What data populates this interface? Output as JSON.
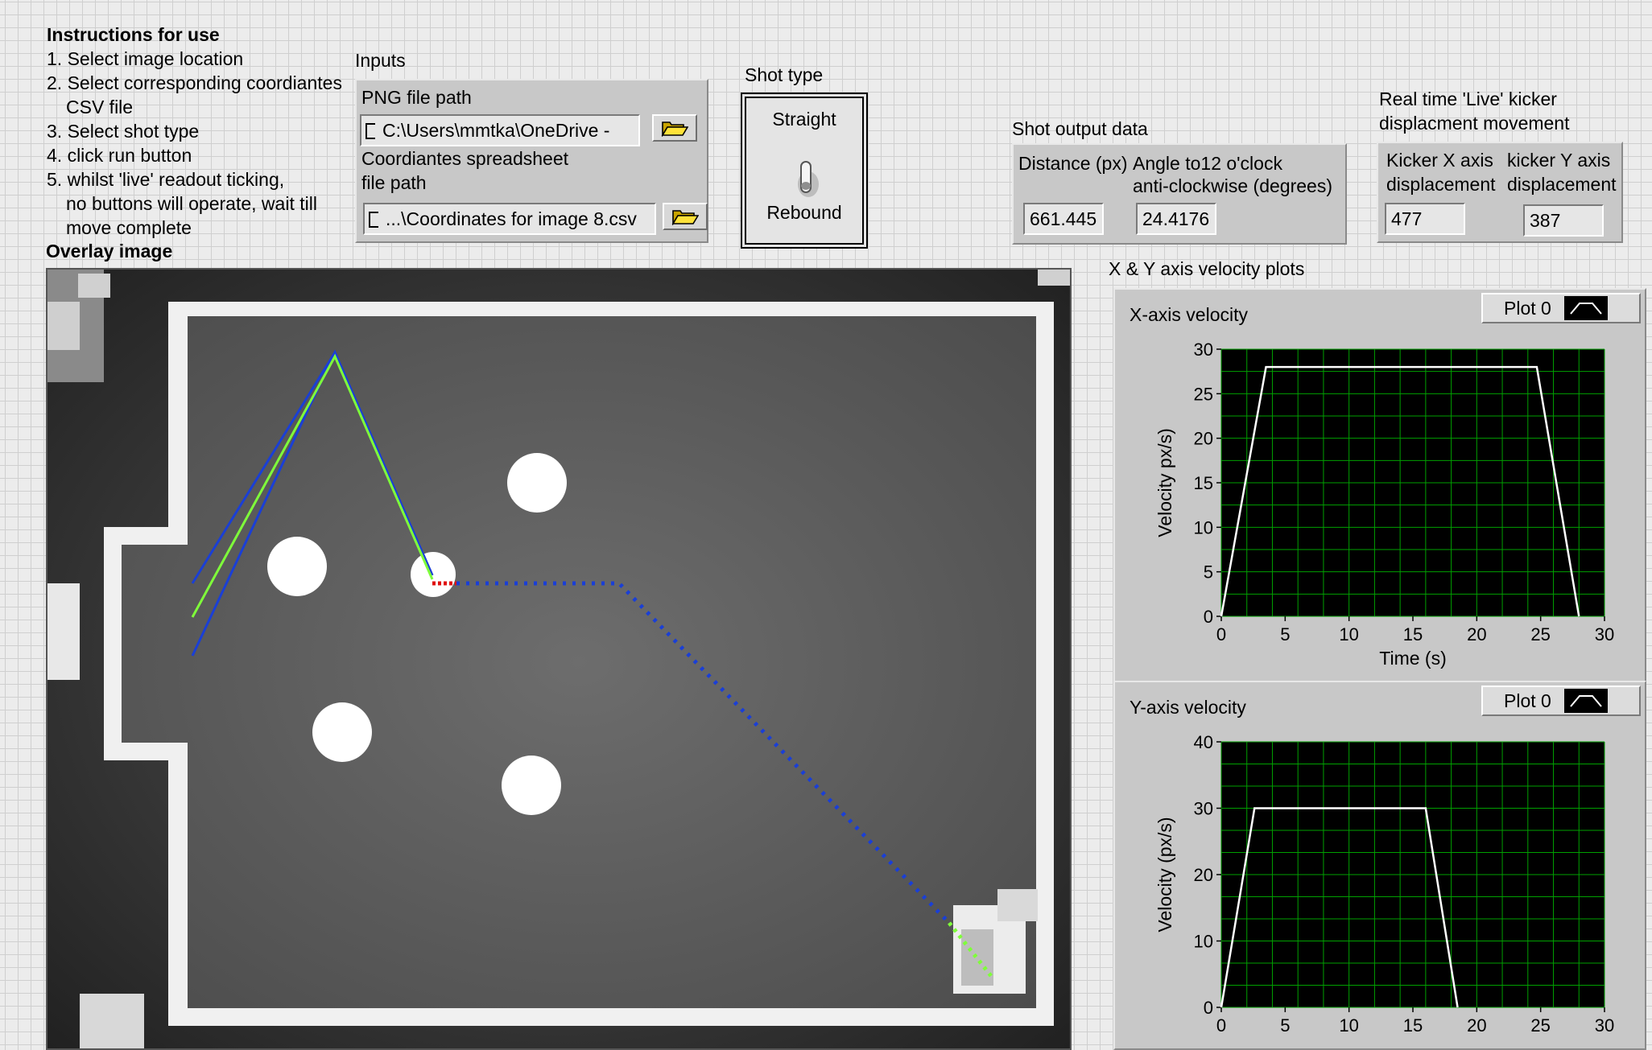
{
  "instructions": {
    "title": "Instructions for use",
    "steps": [
      "1. Select image location",
      "2. Select corresponding coordiantes",
      "CSV file",
      "3. Select shot type",
      "4. click run button",
      "5. whilst 'live' readout ticking,",
      "no buttons will operate, wait till",
      "move complete"
    ]
  },
  "inputs": {
    "section_label": "Inputs",
    "png_label": "PNG file path",
    "png_value": "C:\\Users\\mmtka\\OneDrive -",
    "csv_label_line1": "Coordiantes spreadsheet",
    "csv_label_line2": "file path",
    "csv_value": "...\\Coordinates for image 8.csv"
  },
  "shot_type": {
    "label": "Shot type",
    "option_top": "Straight",
    "option_bottom": "Rebound",
    "selected": "Rebound"
  },
  "shot_output": {
    "section_label": "Shot output data",
    "distance_label": "Distance (px)",
    "angle_label_line1": "Angle to12 o'clock",
    "angle_label_line2": "anti-clockwise (degrees)",
    "distance_value": "661.445",
    "angle_value": "24.4176"
  },
  "kicker": {
    "section_label_line1": "Real time 'Live' kicker",
    "section_label_line2": "displacment movement",
    "x_label_line1": "Kicker X axis",
    "x_label_line2": "displacement",
    "y_label_line1": "kicker Y axis",
    "y_label_line2": "displacement",
    "x_value": "477",
    "y_value": "387"
  },
  "overlay": {
    "label": "Overlay image"
  },
  "velocity_plots": {
    "section_label": "X & Y axis velocity plots",
    "x_plot": {
      "title": "X-axis velocity",
      "legend": "Plot 0"
    },
    "y_plot": {
      "title": "Y-axis velocity",
      "legend": "Plot 0"
    }
  },
  "colors": {
    "plot_bg": "#000000",
    "grid": "#00a000",
    "trace": "#ffffff",
    "path_blue": "#1a3fd6",
    "path_green": "#7fff3a",
    "path_red": "#e01010"
  },
  "icons": {
    "browse": "folder-open-icon",
    "path_prefix": "path-prefix-icon",
    "toggle": "toggle-switch-icon",
    "legend": "line-plot-icon"
  },
  "chart_data": [
    {
      "type": "line",
      "title": "",
      "xlabel": "Time (s)",
      "ylabel": "Velocity px/s)",
      "xlim": [
        0,
        30
      ],
      "ylim": [
        0,
        30
      ],
      "xticks": [
        0,
        5,
        10,
        15,
        20,
        25,
        30
      ],
      "yticks": [
        0,
        5,
        10,
        15,
        20,
        25,
        30
      ],
      "grid": true,
      "series": [
        {
          "name": "Plot 0",
          "x": [
            0,
            3.5,
            24.7,
            28
          ],
          "y": [
            0,
            28,
            28,
            0
          ]
        }
      ]
    },
    {
      "type": "line",
      "title": "",
      "xlabel": "",
      "ylabel": "Velocity (px/s)",
      "xlim": [
        0,
        30
      ],
      "ylim": [
        0,
        40
      ],
      "xticks": [
        0,
        5,
        10,
        15,
        20,
        25,
        30
      ],
      "yticks": [
        0,
        10,
        20,
        30,
        40
      ],
      "grid": true,
      "series": [
        {
          "name": "Plot 0",
          "x": [
            0,
            2.6,
            16,
            18.5
          ],
          "y": [
            0,
            30,
            30,
            0
          ]
        }
      ]
    }
  ]
}
